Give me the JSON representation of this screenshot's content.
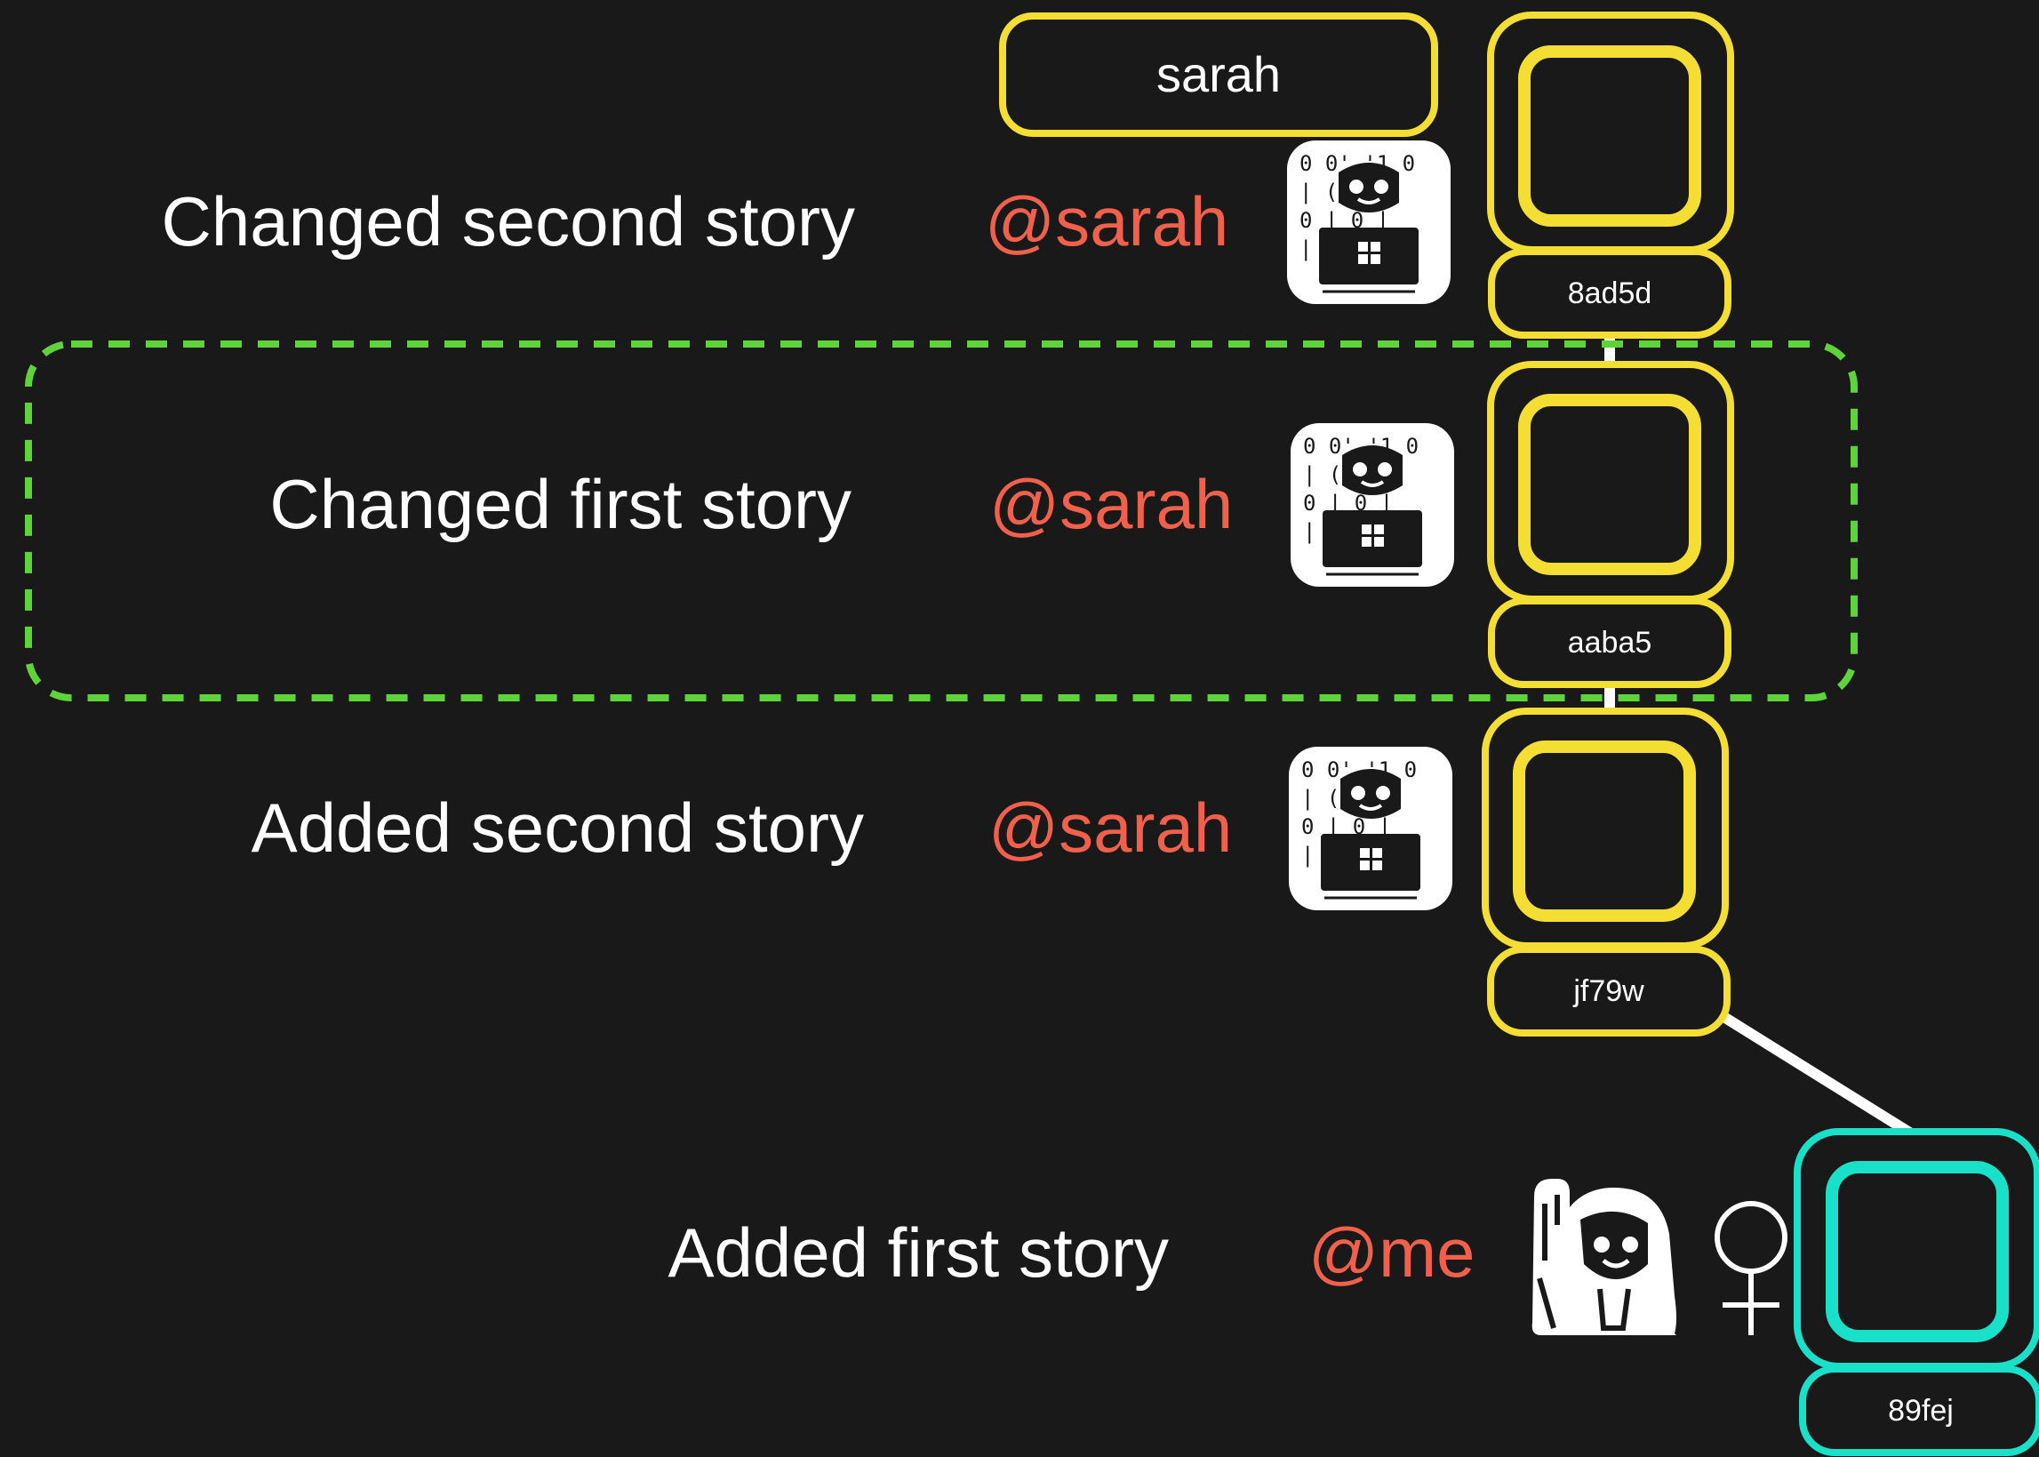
{
  "branch": {
    "label": "sarah"
  },
  "commits": [
    {
      "message": "Changed second story",
      "author": "@sarah",
      "hash": "8ad5d",
      "avatar": "developer-at-laptop-icon"
    },
    {
      "message": "Changed first story",
      "author": "@sarah",
      "hash": "aaba5",
      "avatar": "developer-at-laptop-icon"
    },
    {
      "message": "Added second story",
      "author": "@sarah",
      "hash": "jf79w",
      "avatar": "developer-at-laptop-icon"
    },
    {
      "message": "Added first story",
      "author": "@me",
      "hash": "89fej",
      "avatar": "person-raising-hand-icon",
      "extra_icon": "female-sign-icon"
    }
  ],
  "colors": {
    "background": "#191919",
    "branch_commit": "#f5de33",
    "base_commit": "#19e0c8",
    "author_text": "#f0604a",
    "highlight_dash": "#5fd33a",
    "connector": "#ffffff"
  }
}
